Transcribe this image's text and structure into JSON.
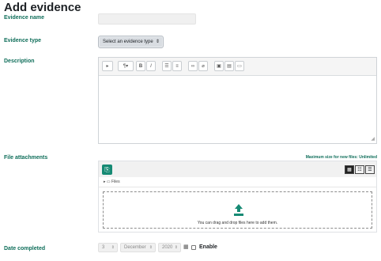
{
  "page": {
    "title": "Add evidence"
  },
  "form": {
    "name_label": "Evidence name",
    "name_value": "",
    "type_label": "Evidence type",
    "type_value": "Select an evidence type",
    "description_label": "Description",
    "attachments_label": "File attachments",
    "max_size": "Maximum size for new files: Unlimited",
    "files_folder": "Files",
    "drop_text": "You can drag and drop files here to add them.",
    "date_label": "Date completed",
    "day": "3",
    "month": "December",
    "year": "2020",
    "enable_label": "Enable"
  },
  "colors": {
    "accent": "#0f6e5a",
    "add_button": "#168a74"
  }
}
